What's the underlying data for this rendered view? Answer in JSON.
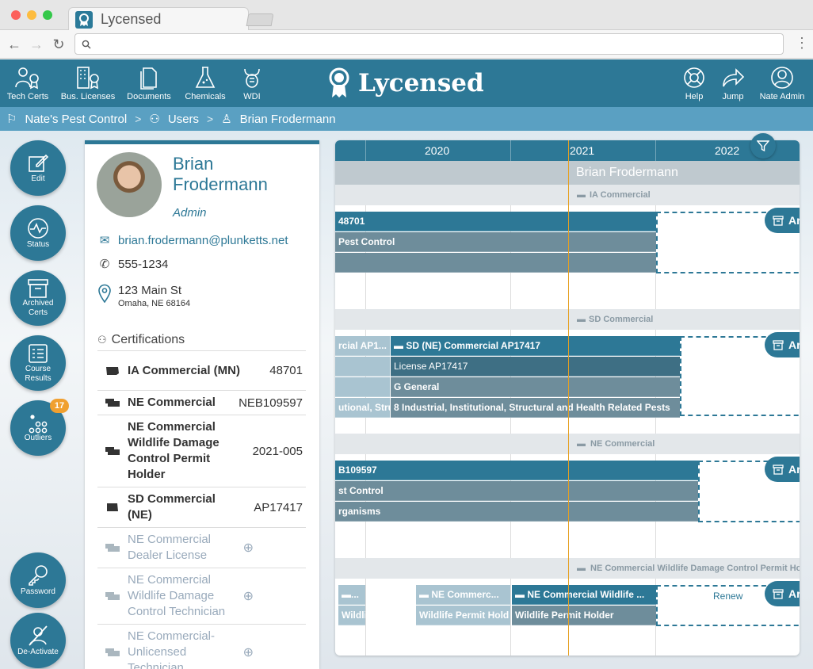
{
  "browser": {
    "tab_title": "Lycensed",
    "url": ""
  },
  "nav": {
    "left": [
      {
        "label": "Tech Certs",
        "icon": "people-award-icon"
      },
      {
        "label": "Bus. Licenses",
        "icon": "building-award-icon"
      },
      {
        "label": "Documents",
        "icon": "documents-icon"
      },
      {
        "label": "Chemicals",
        "icon": "flask-icon"
      },
      {
        "label": "WDI",
        "icon": "wdi-icon"
      }
    ],
    "brand": "Lycensed",
    "right": [
      {
        "label": "Help",
        "icon": "lifebuoy-icon"
      },
      {
        "label": "Jump",
        "icon": "jump-arrow-icon"
      },
      {
        "label": "Nate Admin",
        "icon": "user-circle-icon"
      }
    ]
  },
  "breadcrumb": [
    "Nate's Pest Control",
    "Users",
    "Brian Frodermann"
  ],
  "sidebar": [
    {
      "label": "Edit",
      "icon": "edit-icon"
    },
    {
      "label": "Status",
      "icon": "status-icon"
    },
    {
      "label": "Archived Certs",
      "icon": "archive-icon"
    },
    {
      "label": "Course Results",
      "icon": "course-results-icon"
    },
    {
      "label": "Outliers",
      "icon": "outliers-icon",
      "badge": "17"
    },
    {
      "label": "Password",
      "icon": "key-icon"
    },
    {
      "label": "De-Activate",
      "icon": "deactivate-icon"
    }
  ],
  "profile": {
    "first_name": "Brian",
    "last_name": "Frodermann",
    "role": "Admin",
    "email": "brian.frodermann@plunketts.net",
    "phone": "555-1234",
    "address1": "123 Main St",
    "address2": "Omaha, NE 68164",
    "certs_title": "Certifications",
    "certs": [
      {
        "name": "IA Commercial (MN)",
        "number": "48701",
        "active": true
      },
      {
        "name": "NE Commercial",
        "number": "NEB109597",
        "active": true
      },
      {
        "name": "NE Commercial Wildlife Damage Control Permit Holder",
        "number": "2021-005",
        "active": true
      },
      {
        "name": "SD Commercial (NE)",
        "number": "AP17417",
        "active": true
      },
      {
        "name": "NE Commercial Dealer License",
        "number": "⊕",
        "active": false
      },
      {
        "name": "NE Commercial Wildlife Damage Control Technician",
        "number": "⊕",
        "active": false
      },
      {
        "name": "NE Commercial-Unlicensed Technician",
        "number": "⊕",
        "active": false
      }
    ]
  },
  "timeline": {
    "years": [
      "2020",
      "2021",
      "2022"
    ],
    "user": "Brian Frodermann",
    "sections": [
      {
        "label": "IA Commercial",
        "bars": [
          "48701",
          "Pest Control",
          ""
        ],
        "action": "Ar"
      },
      {
        "label": "SD Commercial",
        "left_bars": [
          "rcial AP1...",
          "",
          "",
          "utional, Stru"
        ],
        "bars": [
          "SD (NE) Commercial AP17417",
          "License AP17417",
          "G General",
          "8 Industrial, Institutional, Structural and Health Related Pests"
        ],
        "action": "Ar"
      },
      {
        "label": "NE Commercial",
        "bars": [
          "B109597",
          "st Control",
          "rganisms"
        ],
        "action": "Ar"
      },
      {
        "label": "NE Commercial Wildlife Damage Control Permit Ho",
        "small_bars": [
          {
            "top": "...",
            "bottom": "Wildli"
          },
          {
            "top": "NE Commerc...",
            "bottom": "Wildlife Permit Hold"
          },
          {
            "top": "NE Commercial Wildlife ...",
            "bottom": "Wildlife Permit Holder"
          }
        ],
        "renew": "Renew",
        "action": "Ar"
      }
    ]
  },
  "colors": {
    "primary": "#2d7896",
    "crumbs": "#5aa0c2",
    "badge": "#f0a030",
    "today": "#e6a020"
  }
}
